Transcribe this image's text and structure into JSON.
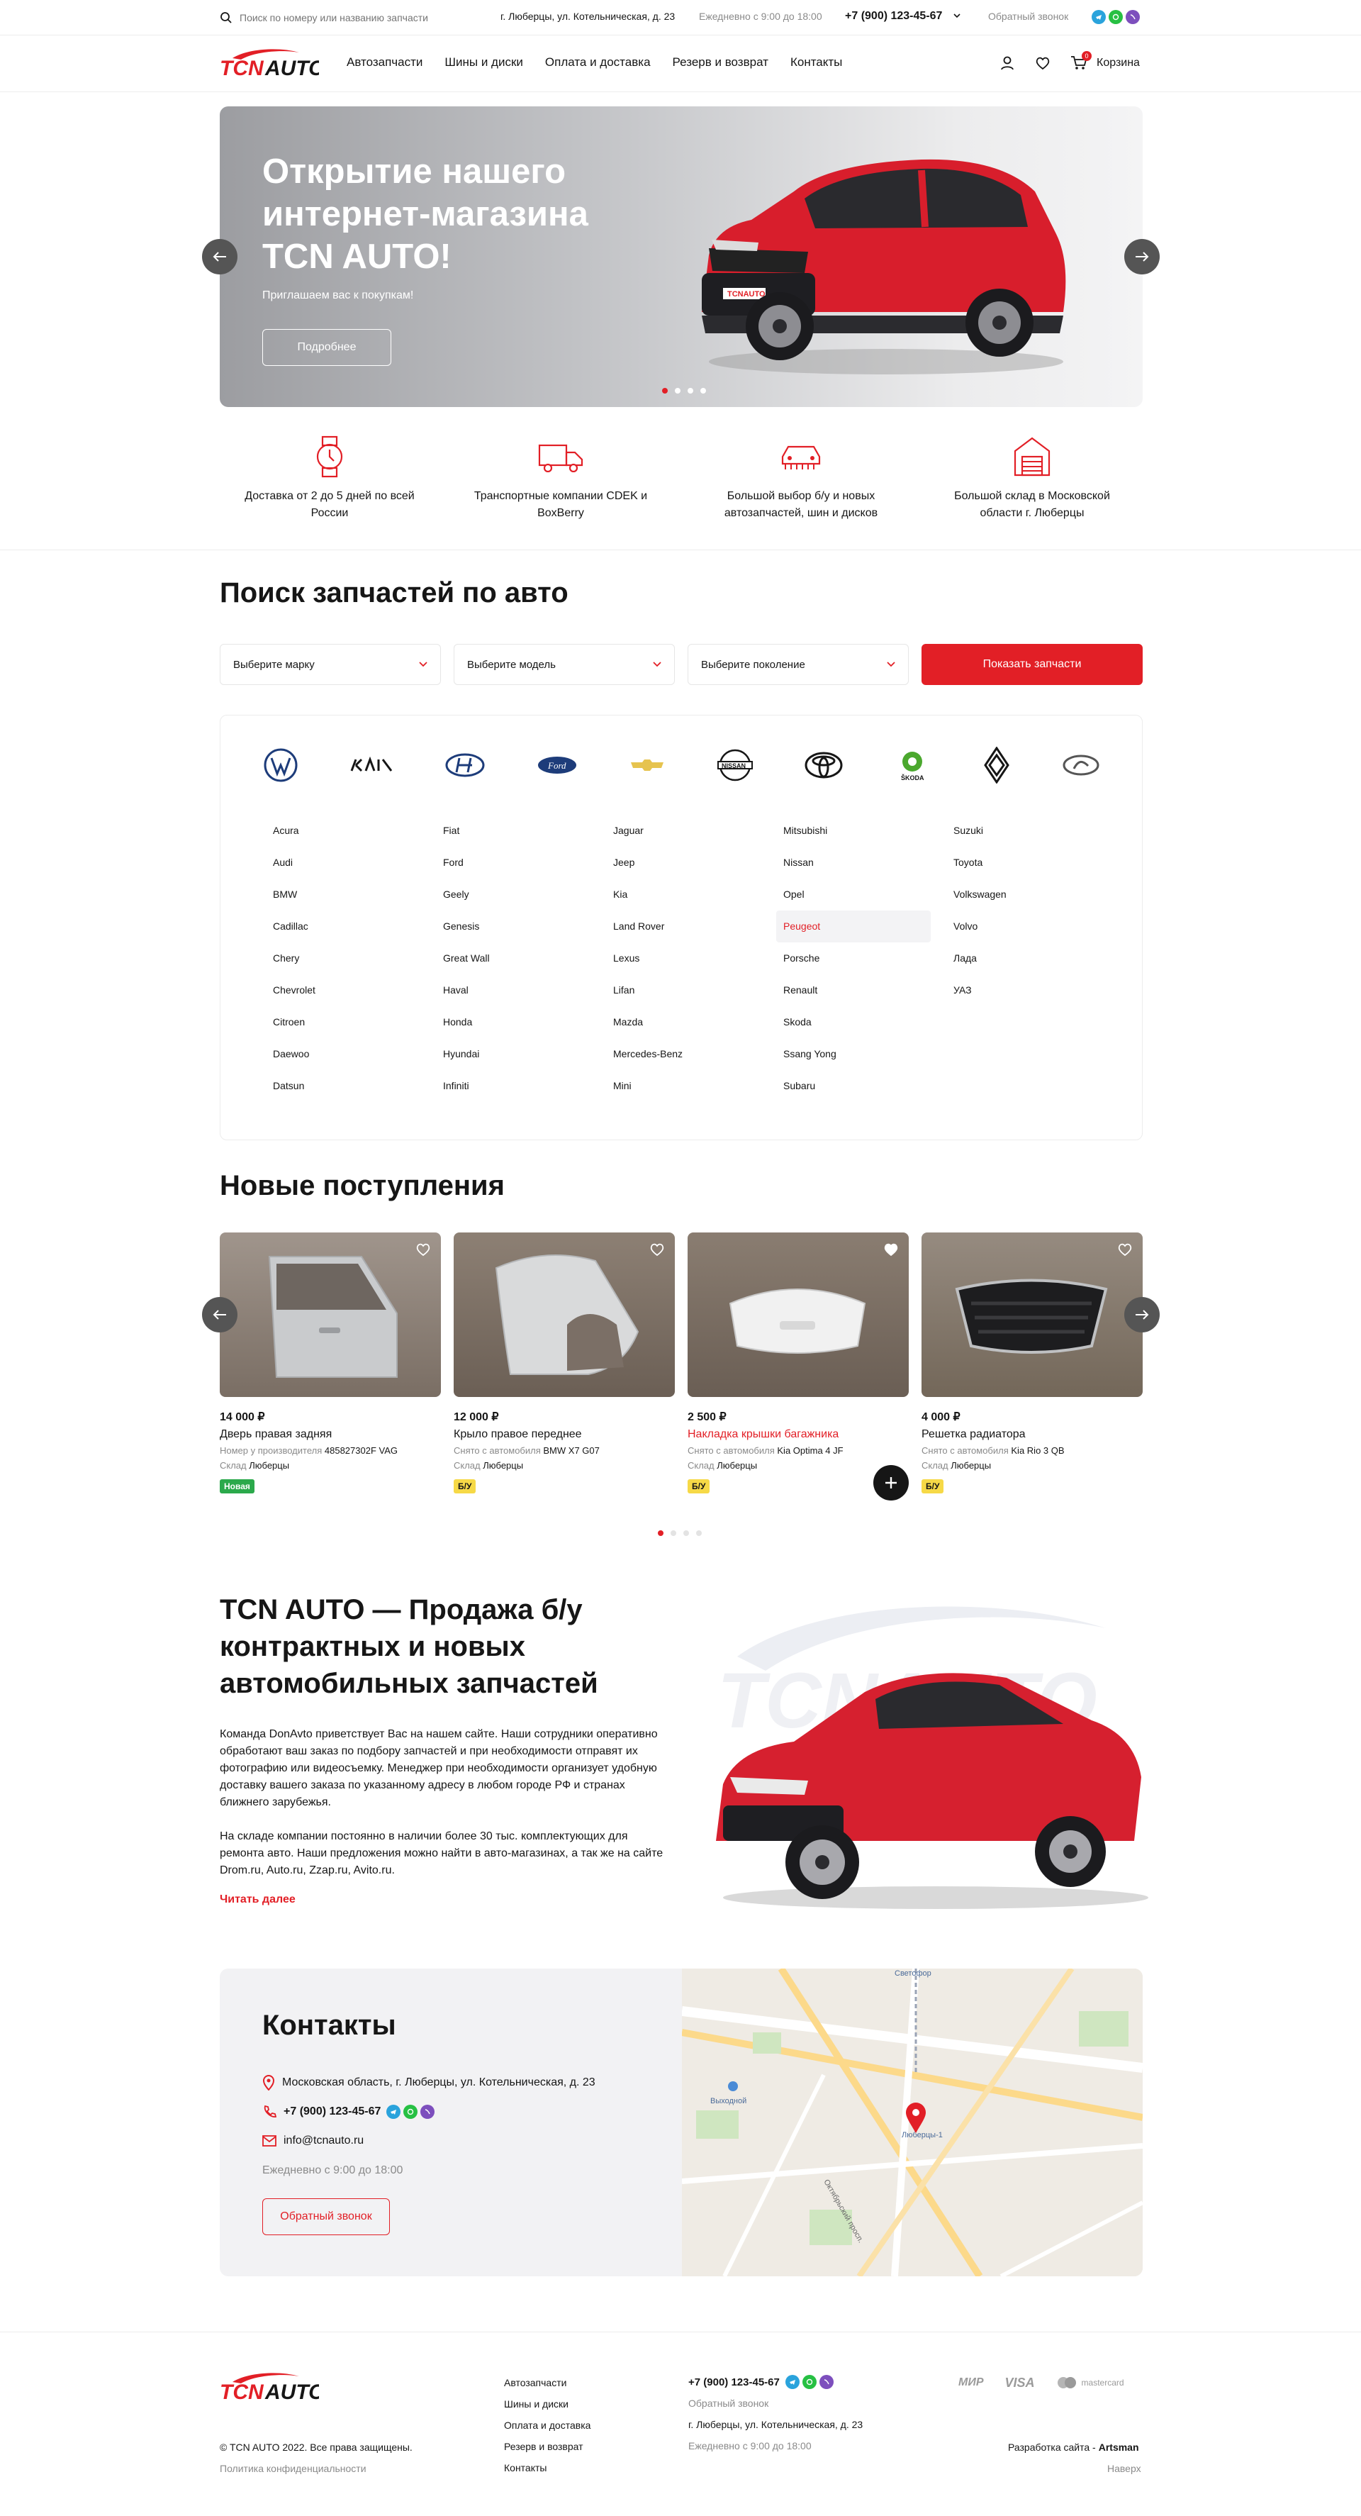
{
  "topbar": {
    "search_placeholder": "Поиск по номеру или названию запчасти",
    "address": "г. Люберцы, ул. Котельническая, д. 23",
    "hours": "Ежедневно с 9:00 до 18:00",
    "phone": "+7 (900) 123-45-67",
    "callback": "Обратный звонок"
  },
  "header": {
    "logo": "TCNAUTO",
    "nav": [
      "Автозапчасти",
      "Шины и диски",
      "Оплата и доставка",
      "Резерв и возврат",
      "Контакты"
    ],
    "cart_label": "Корзина",
    "cart_count": "0"
  },
  "hero": {
    "title": "Открытие нашего интернет-магазина TCN AUTO!",
    "subtitle": "Приглашаем вас к покупкам!",
    "button": "Подробнее",
    "slides": 4,
    "active_slide": 1
  },
  "features": [
    {
      "icon": "watch-icon",
      "text": "Доставка от 2 до 5 дней по всей России"
    },
    {
      "icon": "truck-icon",
      "text": "Транспортные компании CDEK и BoxBerry"
    },
    {
      "icon": "car-parts-icon",
      "text": "Большой выбор б/у и новых автозапчастей, шин и дисков"
    },
    {
      "icon": "warehouse-icon",
      "text": "Большой склад в Московской области г. Люберцы"
    }
  ],
  "search": {
    "title": "Поиск запчастей по авто",
    "brand_select": "Выберите марку",
    "model_select": "Выберите модель",
    "generation_select": "Выберите поколение",
    "button": "Показать запчасти"
  },
  "brand_logos": [
    "Volkswagen",
    "Kia",
    "Hyundai",
    "Ford",
    "Chevrolet",
    "Nissan",
    "Toyota",
    "Skoda",
    "Renault",
    "Lada"
  ],
  "brand_columns": [
    [
      "Acura",
      "Audi",
      "BMW",
      "Cadillac",
      "Chery",
      "Chevrolet",
      "Citroen",
      "Daewoo",
      "Datsun"
    ],
    [
      "Fiat",
      "Ford",
      "Geely",
      "Genesis",
      "Great Wall",
      "Haval",
      "Honda",
      "Hyundai",
      "Infiniti"
    ],
    [
      "Jaguar",
      "Jeep",
      "Kia",
      "Land Rover",
      "Lexus",
      "Lifan",
      "Mazda",
      "Mercedes-Benz",
      "Mini"
    ],
    [
      "Mitsubishi",
      "Nissan",
      "Opel",
      "Peugeot",
      "Porsche",
      "Renault",
      "Skoda",
      "Ssang Yong",
      "Subaru"
    ],
    [
      "Suzuki",
      "Toyota",
      "Volkswagen",
      "Volvo",
      "Лада",
      "УАЗ"
    ]
  ],
  "highlighted_brand": "Peugeot",
  "new_arrivals": {
    "title": "Новые поступления",
    "products": [
      {
        "price": "14 000 ₽",
        "name": "Дверь правая задняя",
        "meta1_label": "Номер у производителя",
        "meta1_value": "485827302F VAG",
        "stock_label": "Склад",
        "stock_value": "Люберцы",
        "badge": "Новая",
        "badge_color": "#2ba94b",
        "name_color": "#161616"
      },
      {
        "price": "12 000 ₽",
        "name": "Крыло правое переднее",
        "meta1_label": "Снято с автомобиля",
        "meta1_value": "BMW X7 G07",
        "stock_label": "Склад",
        "stock_value": "Люберцы",
        "badge": "Б/У",
        "badge_color": "#f6d947",
        "name_color": "#161616"
      },
      {
        "price": "2 500 ₽",
        "name": "Накладка крышки багажника",
        "meta1_label": "Снято с автомобиля",
        "meta1_value": "Kia Optima 4 JF",
        "stock_label": "Склад",
        "stock_value": "Люберцы",
        "badge": "Б/У",
        "badge_color": "#f6d947",
        "name_color": "#e21f26"
      },
      {
        "price": "4 000 ₽",
        "name": "Решетка радиатора",
        "meta1_label": "Снято с автомобиля",
        "meta1_value": "Kia Rio 3 QB",
        "stock_label": "Склад",
        "stock_value": "Люберцы",
        "badge": "Б/У",
        "badge_color": "#f6d947",
        "name_color": "#161616"
      }
    ]
  },
  "about": {
    "title": "TCN AUTO — Продажа б/у контрактных и новых автомобильных запчастей",
    "p1": "Команда DonAvto приветствует Вас на нашем сайте. Наши сотрудники оперативно обработают ваш заказ по подбору запчастей и при необходимости отправят их фотографию или видеосъемку. Менеджер при необходимости организует удобную доставку вашего заказа по указанному адресу в любом городе РФ и странах ближнего зарубежья.",
    "p2": "На складе компании постоянно в наличии более 30 тыс. комплектующих для ремонта авто. Наши предложения можно найти в авто-магазинах, а так же на сайте Drom.ru, Auto.ru, Zzap.ru, Avito.ru.",
    "more": "Читать далее",
    "watermark": "TCNAUTO"
  },
  "contacts": {
    "title": "Контакты",
    "address": "Московская область, г. Люберцы, ул. Котельническая, д. 23",
    "phone": "+7 (900) 123-45-67",
    "email": "info@tcnauto.ru",
    "hours": "Ежедневно с 9:00 до 18:00",
    "callback": "Обратный звонок",
    "map_labels": [
      "Люберцы-1",
      "Выходной",
      "Октябрьский просп.",
      "Светофор"
    ]
  },
  "footer": {
    "logo": "TCNAUTO",
    "copyright": "© TCN AUTO 2022. Все права защищены.",
    "privacy": "Политика конфиденциальности",
    "links": [
      "Автозапчасти",
      "Шины и диски",
      "Оплата и доставка",
      "Резерв и возврат",
      "Контакты"
    ],
    "phone": "+7 (900) 123-45-67",
    "callback": "Обратный звонок",
    "address": "г. Люберцы, ул. Котельническая, д. 23",
    "hours": "Ежедневно с 9:00 до 18:00",
    "payments": [
      "МИР",
      "VISA",
      "mastercard"
    ],
    "dev_label": "Разработка сайта -",
    "dev_name": "Artsman",
    "up": "Наверх"
  },
  "colors": {
    "accent": "#e21f26",
    "text": "#161616",
    "muted": "#8a8a8a",
    "border": "#ececec"
  }
}
